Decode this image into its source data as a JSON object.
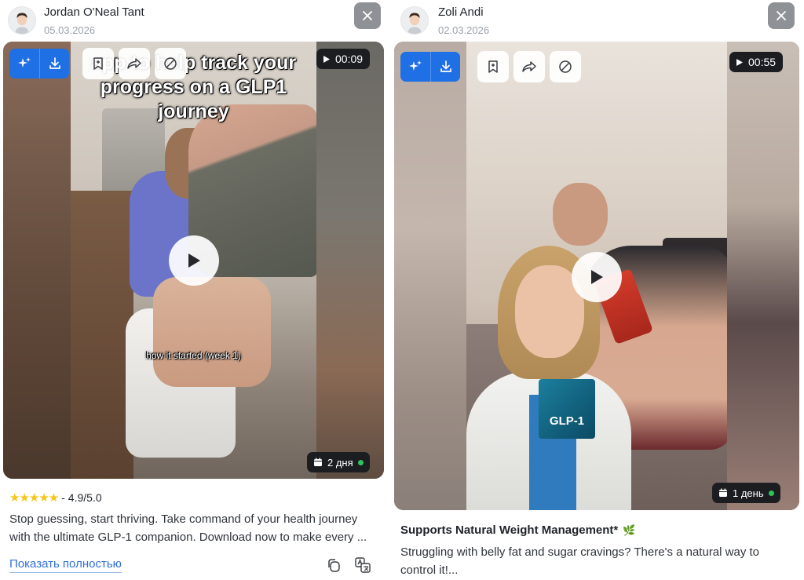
{
  "cards": [
    {
      "author": "Jordan O'Neal Tant",
      "date": "05.03.2026",
      "duration": "00:09",
      "age": "2 дня",
      "video_headline": "app to help track your progress on a GLP1 journey",
      "video_caption": "how it started (week 1)",
      "rating_stars": "★★★★★",
      "rating_text": "- 4.9/5.0",
      "description": "Stop guessing, start thriving. Take command of your health journey with the ultimate GLP-1 companion. Download now to make every ...",
      "show_more": "Показать полностью"
    },
    {
      "author": "Zoli Andi",
      "date": "02.03.2026",
      "duration": "00:55",
      "age": "1 день",
      "ad_title": "Supports Natural Weight Management*",
      "ad_title_emoji": "🌿",
      "box_label": "GLP-1",
      "description": "Struggling with belly fat and sugar cravings? There's a natural way to control it!..."
    }
  ],
  "icons": {
    "sparkle": "sparkle-icon",
    "download": "download-icon",
    "bookmark": "bookmark-icon",
    "share": "share-icon",
    "block": "block-icon",
    "close": "close-icon",
    "play": "play-icon",
    "calendar": "calendar-icon"
  },
  "colors": {
    "accent_blue": "#1f6fe5",
    "link": "#2f6fd6",
    "badge_dark": "#1b1d21",
    "online_green": "#2fc45a",
    "close_gray": "#8e9196",
    "star": "#f5c518"
  }
}
